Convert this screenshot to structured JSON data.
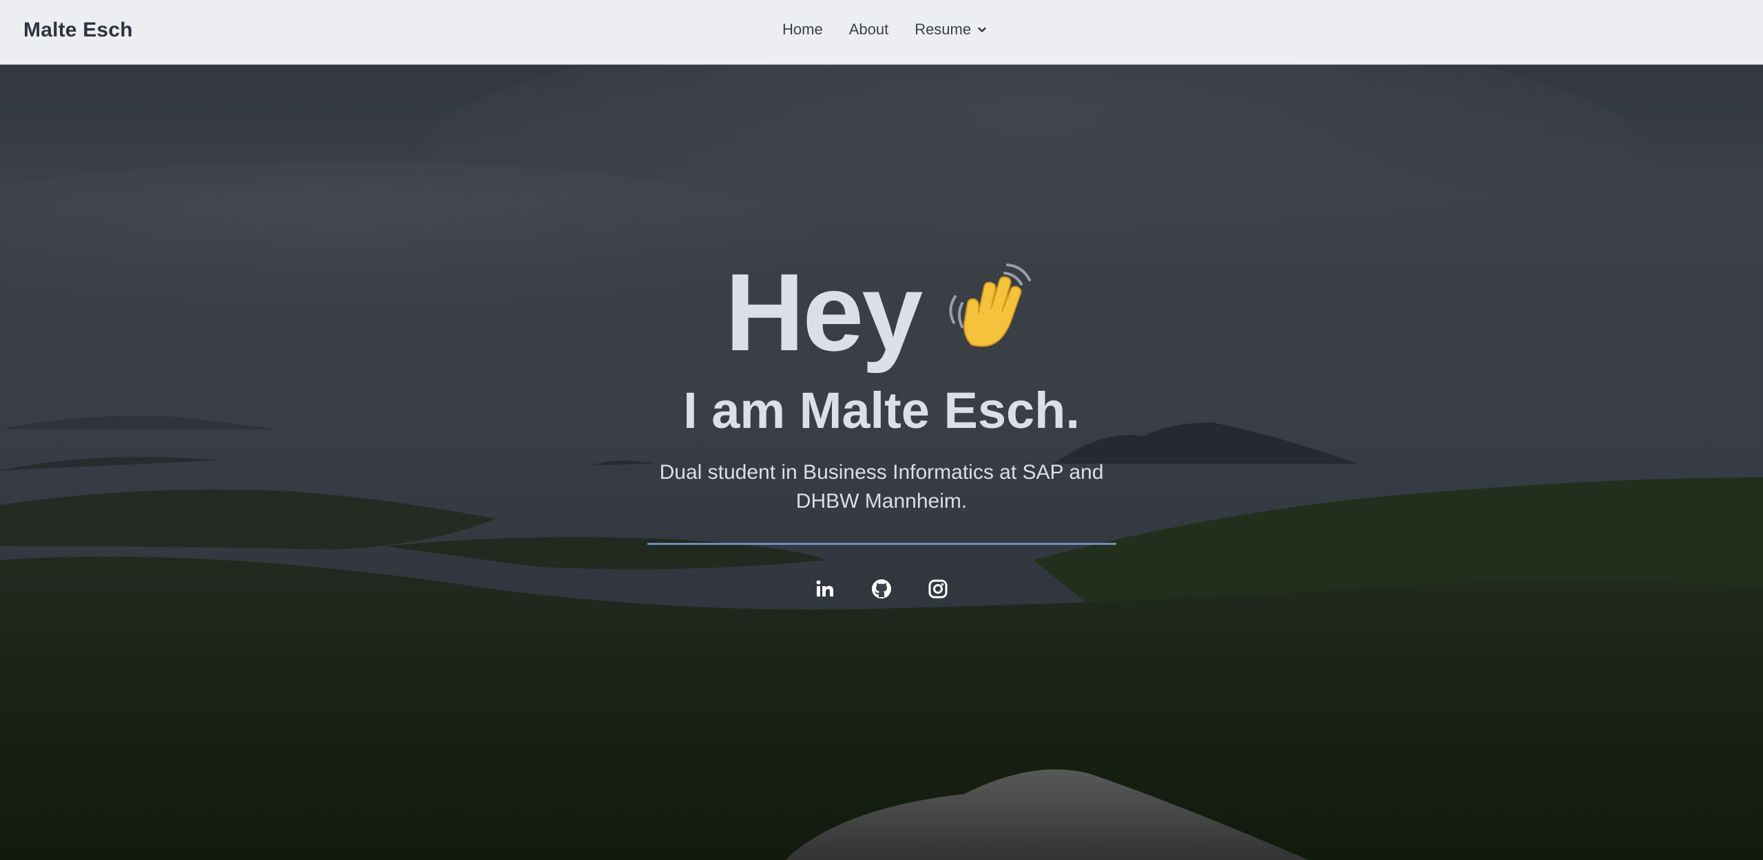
{
  "navbar": {
    "brand": "Malte Esch",
    "links": [
      {
        "label": "Home"
      },
      {
        "label": "About"
      },
      {
        "label": "Resume",
        "icon": "chevron-down-icon"
      }
    ],
    "background": "#eceef2"
  },
  "hero": {
    "heading": "Hey",
    "wave_icon": "waving-hand-icon",
    "title": "I am Malte Esch.",
    "subtitle": "Dual student in Business Informatics at SAP and DHBW Mannheim.",
    "divider_color": "#6d8fbd",
    "text_color": "#dcdee8",
    "socials": [
      {
        "icon": "linkedin-icon"
      },
      {
        "icon": "github-icon"
      },
      {
        "icon": "instagram-icon"
      }
    ]
  }
}
